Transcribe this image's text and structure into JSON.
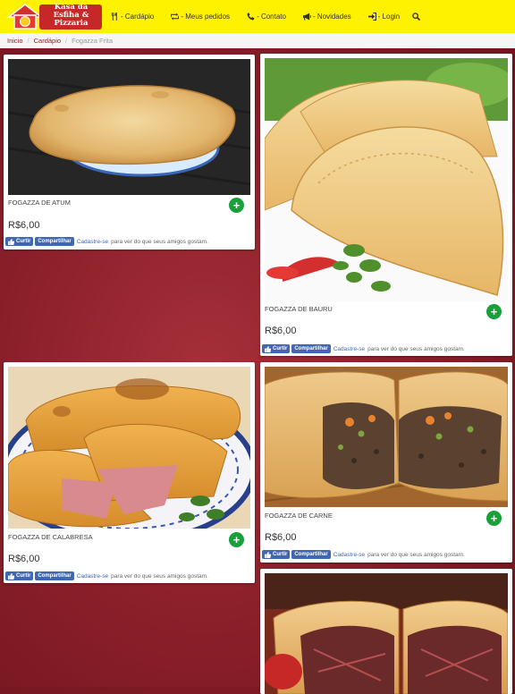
{
  "header": {
    "logo_lines": [
      "Kasa da",
      "Esfiha &",
      "Pizzaria"
    ],
    "nav": [
      {
        "label": "- Cardápio",
        "icon": "cutlery-icon"
      },
      {
        "label": "- Meus pedidos",
        "icon": "orders-icon"
      },
      {
        "label": "- Contato",
        "icon": "phone-icon"
      },
      {
        "label": "- Novidades",
        "icon": "megaphone-icon"
      },
      {
        "label": "- Login",
        "icon": "login-icon"
      }
    ],
    "search_icon": "search-icon"
  },
  "breadcrumb": {
    "home": "Inicio",
    "menu": "Cardápio",
    "current": "Fogazza Frita"
  },
  "products": [
    {
      "name": "FOGAZZA DE ATUM",
      "price": "R$6,00"
    },
    {
      "name": "FOGAZZA DE BAURU",
      "price": "R$6,00"
    },
    {
      "name": "FOGAZZA DE CALABRESA",
      "price": "R$6,00"
    },
    {
      "name": "FOGAZZA DE CARNE",
      "price": "R$6,00"
    }
  ],
  "facebook": {
    "like": "Curtir",
    "share": "Compartilhar",
    "signup_link": "Cadastre-se",
    "signup_text": "para ver do que seus amigos gostam."
  },
  "add_button_label": "+",
  "colors": {
    "header_bg": "#fff200",
    "background": "#8b1f2a",
    "add_button": "#1aa03b",
    "facebook": "#4267b2"
  }
}
